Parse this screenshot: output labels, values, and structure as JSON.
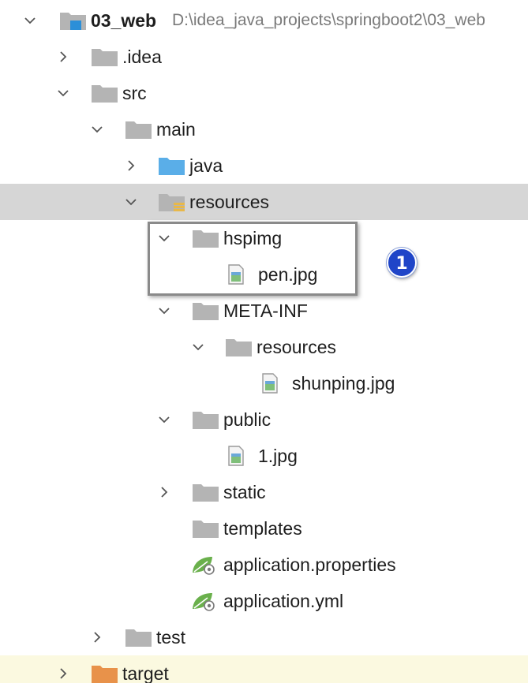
{
  "colors": {
    "folder": "#b4b4b4",
    "source_folder": "#5aaee8",
    "module_accent": "#2c8fd8",
    "excluded_folder": "#e8924a",
    "resources_stripe": "#e8b84a",
    "spring_leaf": "#6ab04c",
    "selected_row": "#d6d6d6",
    "excluded_row": "#fbf9e0",
    "badge": "#1f45c8"
  },
  "tree": {
    "root": {
      "name": "03_web",
      "path": "D:\\idea_java_projects\\springboot2\\03_web"
    },
    "items": {
      "idea": {
        "label": ".idea",
        "icon": "folder-icon"
      },
      "src": {
        "label": "src",
        "icon": "folder-icon"
      },
      "main": {
        "label": "main",
        "icon": "folder-icon"
      },
      "java": {
        "label": "java",
        "icon": "source-folder-icon"
      },
      "resources": {
        "label": "resources",
        "icon": "resources-folder-icon"
      },
      "hspimg": {
        "label": "hspimg",
        "icon": "folder-icon"
      },
      "pen": {
        "label": "pen.jpg",
        "icon": "image-file-icon"
      },
      "metainf": {
        "label": "META-INF",
        "icon": "folder-icon"
      },
      "metainf_resources": {
        "label": "resources",
        "icon": "folder-icon"
      },
      "shunping": {
        "label": "shunping.jpg",
        "icon": "image-file-icon"
      },
      "public": {
        "label": "public",
        "icon": "folder-icon"
      },
      "one_jpg": {
        "label": "1.jpg",
        "icon": "image-file-icon"
      },
      "static": {
        "label": "static",
        "icon": "folder-icon"
      },
      "templates": {
        "label": "templates",
        "icon": "folder-icon"
      },
      "app_properties": {
        "label": "application.properties",
        "icon": "spring-config-icon"
      },
      "app_yml": {
        "label": "application.yml",
        "icon": "spring-config-icon"
      },
      "test": {
        "label": "test",
        "icon": "folder-icon"
      },
      "target": {
        "label": "target",
        "icon": "excluded-folder-icon"
      }
    }
  },
  "annotation": {
    "badge_number": "1"
  }
}
